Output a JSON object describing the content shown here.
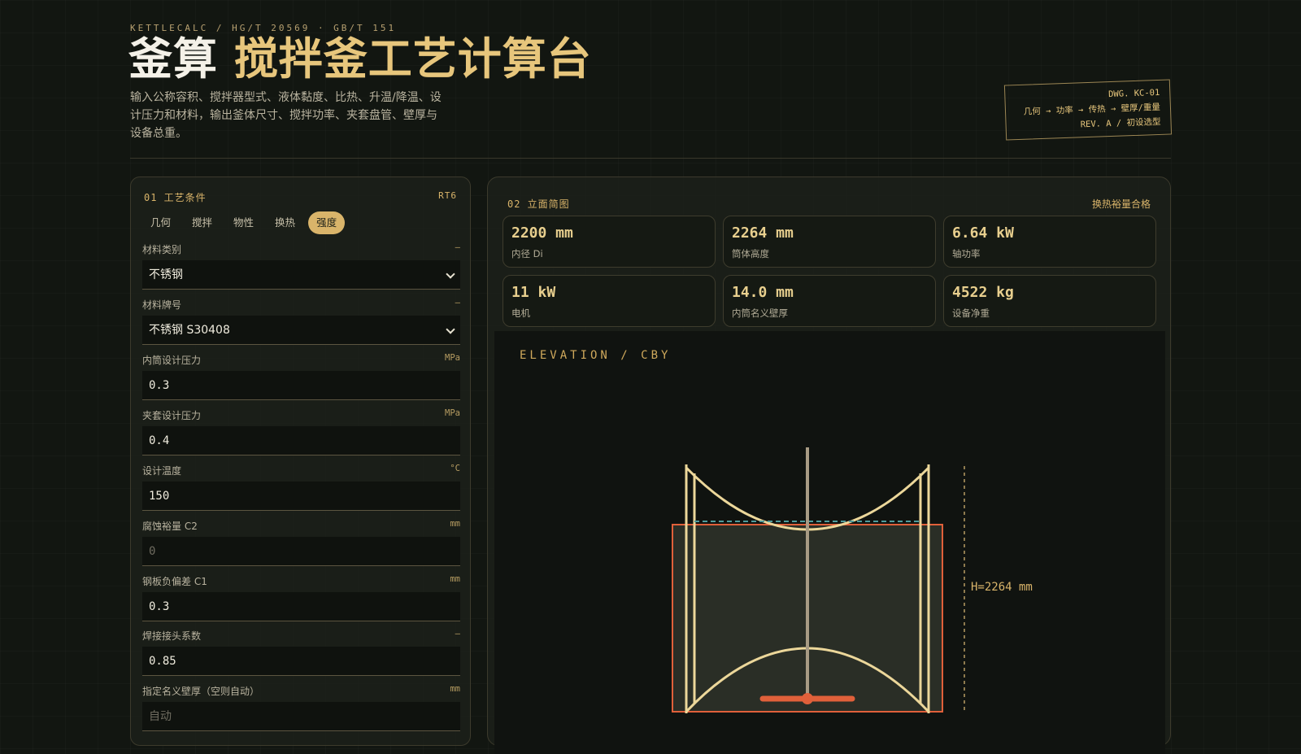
{
  "header": {
    "kicker": "KETTLECALC / HG/T 20569 · GB/T 151",
    "title_main": "釜算",
    "title_accent": "搅拌釜工艺计算台",
    "subtitle": "输入公称容积、搅拌器型式、液体黏度、比热、升温/降温、设计压力和材料，输出釜体尺寸、搅拌功率、夹套盘管、壁厚与设备总重。",
    "stamp": {
      "line1": "DWG. KC-01",
      "line2": "几何 → 功率 → 传热 → 壁厚/重量",
      "line3": "REV. A / 初设选型"
    }
  },
  "left_panel": {
    "title": "01 工艺条件",
    "badge": "RT6",
    "tabs": [
      "几何",
      "搅拌",
      "物性",
      "换热",
      "强度"
    ],
    "active_tab": "强度",
    "fields": [
      {
        "label": "材料类别",
        "unit": "—",
        "value": "不锈钢",
        "kind": "select"
      },
      {
        "label": "材料牌号",
        "unit": "—",
        "value": "不锈钢 S30408",
        "kind": "select"
      },
      {
        "label": "内筒设计压力",
        "unit": "MPa",
        "value": "0.3",
        "kind": "input"
      },
      {
        "label": "夹套设计压力",
        "unit": "MPa",
        "value": "0.4",
        "kind": "input"
      },
      {
        "label": "设计温度",
        "unit": "°C",
        "value": "150",
        "kind": "input"
      },
      {
        "label": "腐蚀裕量 C2",
        "unit": "mm",
        "placeholder": "0",
        "kind": "input"
      },
      {
        "label": "钢板负偏差 C1",
        "unit": "mm",
        "value": "0.3",
        "kind": "input"
      },
      {
        "label": "焊接接头系数",
        "unit": "—",
        "value": "0.85",
        "kind": "input"
      },
      {
        "label": "指定名义壁厚（空则自动）",
        "unit": "mm",
        "placeholder": "自动",
        "kind": "input"
      }
    ]
  },
  "right_panel": {
    "title": "02 立面简图",
    "status": "换热裕量合格",
    "stats": [
      {
        "value": "2200 mm",
        "label": "内径 Di"
      },
      {
        "value": "2264 mm",
        "label": "筒体高度"
      },
      {
        "value": "6.64 kW",
        "label": "轴功率"
      },
      {
        "value": "11 kW",
        "label": "电机"
      },
      {
        "value": "14.0 mm",
        "label": "内筒名义壁厚"
      },
      {
        "value": "4522 kg",
        "label": "设备净重"
      }
    ],
    "drawing": {
      "label": "ELEVATION / CBY",
      "height_annotation": "H=2264 mm"
    }
  },
  "colors": {
    "accent": "#e7c67c",
    "jacket": "#e0603a",
    "vessel": "#ecd79a",
    "liquid_line": "#4f9b9b",
    "background": "#121611"
  }
}
